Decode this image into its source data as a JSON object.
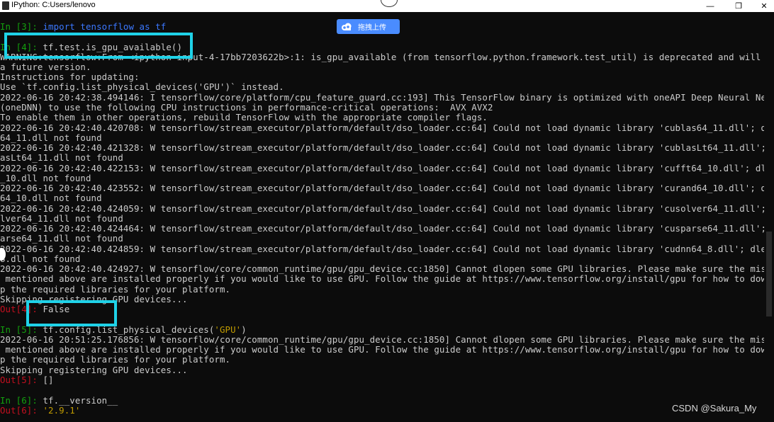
{
  "window": {
    "title": "IPython: C:Users/lenovo",
    "controls": {
      "minimize": "—",
      "maximize": "❐",
      "close": "✕"
    }
  },
  "upload_button": {
    "label": "拖拽上传"
  },
  "watermark": "CSDN @Sakura_My",
  "console": {
    "l01": {
      "p": "In [3]: ",
      "code": "import tensorflow as tf"
    },
    "l02": {
      "p": "In [4]: ",
      "code": "tf.test.is_gpu_available()"
    },
    "l03": {
      "text": "WARNING:tensorflow:From <ipython-input-4-17bb7203622b>:1: is_gpu_available (from tensorflow.python.framework.test_util) is deprecated and will be removed in"
    },
    "l04": {
      "text": "a future version."
    },
    "l05": {
      "text": "Instructions for updating:"
    },
    "l06": {
      "text": "Use `tf.config.list_physical_devices('GPU')` instead."
    },
    "l07": {
      "text": "2022-06-16 20:42:38.494146: I tensorflow/core/platform/cpu_feature_guard.cc:193] This TensorFlow binary is optimized with oneAPI Deep Neural Network Library"
    },
    "l08": {
      "text": "(oneDNN) to use the following CPU instructions in performance-critical operations:  AVX AVX2"
    },
    "l09": {
      "text": "To enable them in other operations, rebuild TensorFlow with the appropriate compiler flags."
    },
    "l10": {
      "text": "2022-06-16 20:42:40.420708: W tensorflow/stream_executor/platform/default/dso_loader.cc:64] Could not load dynamic library 'cublas64_11.dll'; dlerror: cublas"
    },
    "l11": {
      "text": "64_11.dll not found"
    },
    "l12": {
      "text": "2022-06-16 20:42:40.421328: W tensorflow/stream_executor/platform/default/dso_loader.cc:64] Could not load dynamic library 'cublasLt64_11.dll'; dlerror: cubl"
    },
    "l13": {
      "text": "asLt64_11.dll not found"
    },
    "l14": {
      "text": "2022-06-16 20:42:40.422153: W tensorflow/stream_executor/platform/default/dso_loader.cc:64] Could not load dynamic library 'cufft64_10.dll'; dlerror: cufft64"
    },
    "l15": {
      "text": "_10.dll not found"
    },
    "l16": {
      "text": "2022-06-16 20:42:40.423552: W tensorflow/stream_executor/platform/default/dso_loader.cc:64] Could not load dynamic library 'curand64_10.dll'; dlerror: curand"
    },
    "l17": {
      "text": "64_10.dll not found"
    },
    "l18": {
      "text": "2022-06-16 20:42:40.424059: W tensorflow/stream_executor/platform/default/dso_loader.cc:64] Could not load dynamic library 'cusolver64_11.dll'; dlerror: cuso"
    },
    "l19": {
      "text": "lver64_11.dll not found"
    },
    "l20": {
      "text": "2022-06-16 20:42:40.424464: W tensorflow/stream_executor/platform/default/dso_loader.cc:64] Could not load dynamic library 'cusparse64_11.dll'; dlerror: cusp"
    },
    "l21": {
      "text": "arse64_11.dll not found"
    },
    "l22": {
      "text": "2022-06-16 20:42:40.424859: W tensorflow/stream_executor/platform/default/dso_loader.cc:64] Could not load dynamic library 'cudnn64_8.dll'; dlerror: cudnn64_"
    },
    "l23": {
      "text": "8.dll not found"
    },
    "l24": {
      "text": "2022-06-16 20:42:40.424927: W tensorflow/core/common_runtime/gpu/gpu_device.cc:1850] Cannot dlopen some GPU libraries. Please make sure the missing libraries"
    },
    "l25": {
      "text": " mentioned above are installed properly if you would like to use GPU. Follow the guide at https://www.tensorflow.org/install/gpu for how to download and setu"
    },
    "l26": {
      "text": "p the required libraries for your platform."
    },
    "l27": {
      "text": "Skipping registering GPU devices..."
    },
    "l28": {
      "p": "Out[4]: ",
      "code": "False"
    },
    "l29": {
      "p": "In [5]: ",
      "code": "tf.config.list_physical_devices(",
      "str": "'GPU'",
      "tail": ")"
    },
    "l30": {
      "text": "2022-06-16 20:51:25.176856: W tensorflow/core/common_runtime/gpu/gpu_device.cc:1850] Cannot dlopen some GPU libraries. Please make sure the missing libraries"
    },
    "l31": {
      "text": " mentioned above are installed properly if you would like to use GPU. Follow the guide at https://www.tensorflow.org/install/gpu for how to download and setu"
    },
    "l32": {
      "text": "p the required libraries for your platform."
    },
    "l33": {
      "text": "Skipping registering GPU devices..."
    },
    "l34": {
      "p": "Out[5]: ",
      "code": "[]"
    },
    "l35": {
      "p": "In [6]: ",
      "code": "tf.__version__"
    },
    "l36": {
      "p": "Out[6]: ",
      "code": "'2.9.1'"
    }
  }
}
